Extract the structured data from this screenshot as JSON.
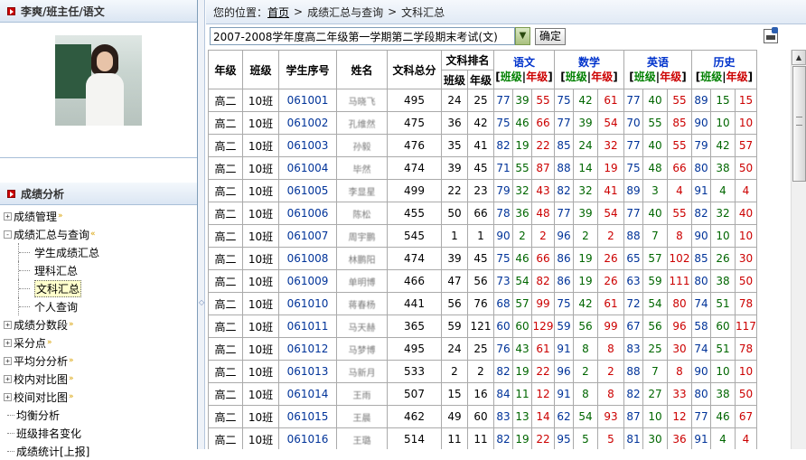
{
  "user": {
    "title": "李爽/班主任/语文"
  },
  "section": {
    "title": "成绩分析"
  },
  "tree": [
    {
      "label": "成绩管理",
      "type": "collapsed",
      "arrow": "»"
    },
    {
      "label": "成绩汇总与查询",
      "type": "expanded",
      "arrow": "«"
    },
    {
      "label": "学生成绩汇总",
      "type": "sub"
    },
    {
      "label": "理科汇总",
      "type": "sub"
    },
    {
      "label": "文科汇总",
      "type": "sub",
      "selected": true
    },
    {
      "label": "个人查询",
      "type": "sub"
    },
    {
      "label": "成绩分数段",
      "type": "collapsed",
      "arrow": "»"
    },
    {
      "label": "采分点",
      "type": "collapsed",
      "arrow": "»"
    },
    {
      "label": "平均分分析",
      "type": "collapsed",
      "arrow": "»"
    },
    {
      "label": "校内对比图",
      "type": "collapsed",
      "arrow": "»"
    },
    {
      "label": "校间对比图",
      "type": "collapsed",
      "arrow": "»"
    },
    {
      "label": "均衡分析",
      "type": "plain"
    },
    {
      "label": "班级排名变化",
      "type": "plain"
    },
    {
      "label": "成绩统计[上报]",
      "type": "plain"
    }
  ],
  "breadcrumb": {
    "prefix": "您的位置：",
    "home": "首页",
    "sep": ">",
    "level1": "成绩汇总与查询",
    "level2": "文科汇总"
  },
  "exam": {
    "selected": "2007-2008学年度高二年级第一学期第二学段期末考试(文)",
    "ok_label": "确定"
  },
  "table": {
    "headers": {
      "grade": "年级",
      "class": "班级",
      "sid": "学生序号",
      "name": "姓名",
      "total": "文科总分",
      "rank": "文科排名",
      "rank_class": "班级",
      "rank_grade": "年级",
      "bj": "班级",
      "nj": "年级",
      "lb": "[",
      "rb": "]",
      "bar": "|"
    },
    "subjects": [
      "语文",
      "数学",
      "英语",
      "历史"
    ],
    "rows": [
      {
        "grade": "高二",
        "cls": "10班",
        "sid": "061001",
        "name": "马晓飞",
        "total": "495",
        "rc": "24",
        "rg": "25",
        "s": [
          [
            "77",
            "39",
            "55"
          ],
          [
            "75",
            "42",
            "61"
          ],
          [
            "77",
            "40",
            "55"
          ],
          [
            "89",
            "15",
            "15"
          ]
        ]
      },
      {
        "grade": "高二",
        "cls": "10班",
        "sid": "061002",
        "name": "孔维然",
        "total": "475",
        "rc": "36",
        "rg": "42",
        "s": [
          [
            "75",
            "46",
            "66"
          ],
          [
            "77",
            "39",
            "54"
          ],
          [
            "70",
            "55",
            "85"
          ],
          [
            "90",
            "10",
            "10"
          ]
        ]
      },
      {
        "grade": "高二",
        "cls": "10班",
        "sid": "061003",
        "name": "孙毅",
        "total": "476",
        "rc": "35",
        "rg": "41",
        "s": [
          [
            "82",
            "19",
            "22"
          ],
          [
            "85",
            "24",
            "32"
          ],
          [
            "77",
            "40",
            "55"
          ],
          [
            "79",
            "42",
            "57"
          ]
        ]
      },
      {
        "grade": "高二",
        "cls": "10班",
        "sid": "061004",
        "name": "毕然",
        "total": "474",
        "rc": "39",
        "rg": "45",
        "s": [
          [
            "71",
            "55",
            "87"
          ],
          [
            "88",
            "14",
            "19"
          ],
          [
            "75",
            "48",
            "66"
          ],
          [
            "80",
            "38",
            "50"
          ]
        ]
      },
      {
        "grade": "高二",
        "cls": "10班",
        "sid": "061005",
        "name": "李显星",
        "total": "499",
        "rc": "22",
        "rg": "23",
        "s": [
          [
            "79",
            "32",
            "43"
          ],
          [
            "82",
            "32",
            "41"
          ],
          [
            "89",
            "3",
            "4"
          ],
          [
            "91",
            "4",
            "4"
          ]
        ]
      },
      {
        "grade": "高二",
        "cls": "10班",
        "sid": "061006",
        "name": "陈松",
        "total": "455",
        "rc": "50",
        "rg": "66",
        "s": [
          [
            "78",
            "36",
            "48"
          ],
          [
            "77",
            "39",
            "54"
          ],
          [
            "77",
            "40",
            "55"
          ],
          [
            "82",
            "32",
            "40"
          ]
        ]
      },
      {
        "grade": "高二",
        "cls": "10班",
        "sid": "061007",
        "name": "周宇鹏",
        "total": "545",
        "rc": "1",
        "rg": "1",
        "s": [
          [
            "90",
            "2",
            "2"
          ],
          [
            "96",
            "2",
            "2"
          ],
          [
            "88",
            "7",
            "8"
          ],
          [
            "90",
            "10",
            "10"
          ]
        ]
      },
      {
        "grade": "高二",
        "cls": "10班",
        "sid": "061008",
        "name": "林鹏阳",
        "total": "474",
        "rc": "39",
        "rg": "45",
        "s": [
          [
            "75",
            "46",
            "66"
          ],
          [
            "86",
            "19",
            "26"
          ],
          [
            "65",
            "57",
            "102"
          ],
          [
            "85",
            "26",
            "30"
          ]
        ]
      },
      {
        "grade": "高二",
        "cls": "10班",
        "sid": "061009",
        "name": "单明博",
        "total": "466",
        "rc": "47",
        "rg": "56",
        "s": [
          [
            "73",
            "54",
            "82"
          ],
          [
            "86",
            "19",
            "26"
          ],
          [
            "63",
            "59",
            "111"
          ],
          [
            "80",
            "38",
            "50"
          ]
        ]
      },
      {
        "grade": "高二",
        "cls": "10班",
        "sid": "061010",
        "name": "蒋春杨",
        "total": "441",
        "rc": "56",
        "rg": "76",
        "s": [
          [
            "68",
            "57",
            "99"
          ],
          [
            "75",
            "42",
            "61"
          ],
          [
            "72",
            "54",
            "80"
          ],
          [
            "74",
            "51",
            "78"
          ]
        ]
      },
      {
        "grade": "高二",
        "cls": "10班",
        "sid": "061011",
        "name": "马天赫",
        "total": "365",
        "rc": "59",
        "rg": "121",
        "s": [
          [
            "60",
            "60",
            "129"
          ],
          [
            "59",
            "56",
            "99"
          ],
          [
            "67",
            "56",
            "96"
          ],
          [
            "58",
            "60",
            "117"
          ]
        ]
      },
      {
        "grade": "高二",
        "cls": "10班",
        "sid": "061012",
        "name": "马梦博",
        "total": "495",
        "rc": "24",
        "rg": "25",
        "s": [
          [
            "76",
            "43",
            "61"
          ],
          [
            "91",
            "8",
            "8"
          ],
          [
            "83",
            "25",
            "30"
          ],
          [
            "74",
            "51",
            "78"
          ]
        ]
      },
      {
        "grade": "高二",
        "cls": "10班",
        "sid": "061013",
        "name": "马新月",
        "total": "533",
        "rc": "2",
        "rg": "2",
        "s": [
          [
            "82",
            "19",
            "22"
          ],
          [
            "96",
            "2",
            "2"
          ],
          [
            "88",
            "7",
            "8"
          ],
          [
            "90",
            "10",
            "10"
          ]
        ]
      },
      {
        "grade": "高二",
        "cls": "10班",
        "sid": "061014",
        "name": "王雨",
        "total": "507",
        "rc": "15",
        "rg": "16",
        "s": [
          [
            "84",
            "11",
            "12"
          ],
          [
            "91",
            "8",
            "8"
          ],
          [
            "82",
            "27",
            "33"
          ],
          [
            "80",
            "38",
            "50"
          ]
        ]
      },
      {
        "grade": "高二",
        "cls": "10班",
        "sid": "061015",
        "name": "王晨",
        "total": "462",
        "rc": "49",
        "rg": "60",
        "s": [
          [
            "83",
            "13",
            "14"
          ],
          [
            "62",
            "54",
            "93"
          ],
          [
            "87",
            "10",
            "12"
          ],
          [
            "77",
            "46",
            "67"
          ]
        ]
      },
      {
        "grade": "高二",
        "cls": "10班",
        "sid": "061016",
        "name": "王璐",
        "total": "514",
        "rc": "11",
        "rg": "11",
        "s": [
          [
            "82",
            "19",
            "22"
          ],
          [
            "95",
            "5",
            "5"
          ],
          [
            "81",
            "30",
            "36"
          ],
          [
            "91",
            "4",
            "4"
          ]
        ]
      }
    ]
  },
  "colors": {
    "subject": "#0033cc",
    "class_tag": "#008000",
    "grade_tag": "#cc0000",
    "accent": "#003399"
  }
}
